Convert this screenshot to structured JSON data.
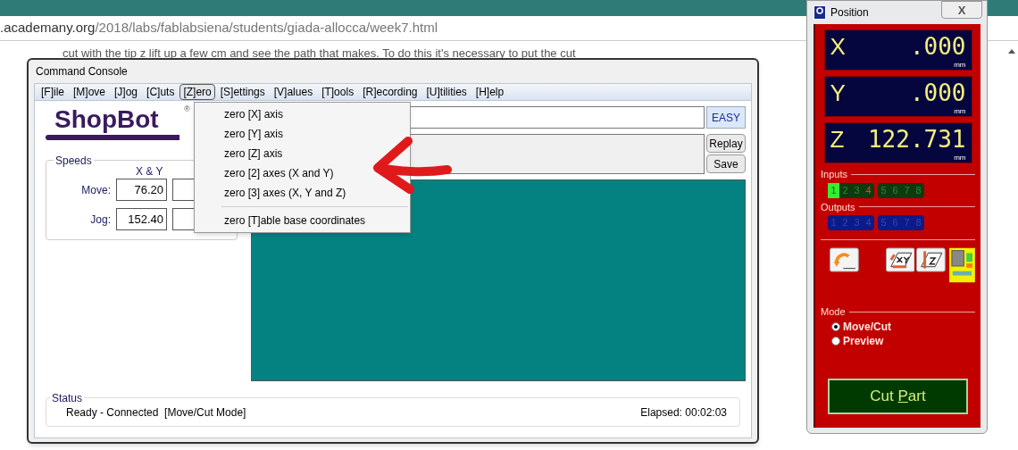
{
  "browser": {
    "url_host": ".academany.org",
    "url_path": "/2018/labs/fablabsiena/students/giada-allocca/week7.html",
    "page_text": "cut with the tip z lift up a few cm and see the path that makes. To do this it's necessary to put the cut"
  },
  "console": {
    "title": "Command Console",
    "menu": [
      {
        "label": "[F]ile",
        "selected": false
      },
      {
        "label": "[M]ove",
        "selected": false
      },
      {
        "label": "[J]og",
        "selected": false
      },
      {
        "label": "[C]uts",
        "selected": false
      },
      {
        "label": "[Z]ero",
        "selected": true
      },
      {
        "label": "[S]ettings",
        "selected": false
      },
      {
        "label": "[V]alues",
        "selected": false
      },
      {
        "label": "[T]ools",
        "selected": false
      },
      {
        "label": "[R]ecording",
        "selected": false
      },
      {
        "label": "[U]tilities",
        "selected": false
      },
      {
        "label": "[H]elp",
        "selected": false
      }
    ],
    "dropdown": [
      {
        "kind": "option",
        "label": "zero [X] axis"
      },
      {
        "kind": "option",
        "label": "zero [Y] axis"
      },
      {
        "kind": "option",
        "label": "zero [Z] axis"
      },
      {
        "kind": "option",
        "label": "zero [2] axes (X and Y)"
      },
      {
        "kind": "option",
        "label": "zero [3] axes (X, Y and Z)"
      },
      {
        "kind": "separator"
      },
      {
        "kind": "option",
        "label": "zero [T]able base coordinates"
      }
    ],
    "logo": {
      "text": "ShopBot",
      "mark": "®"
    },
    "speeds": {
      "title": "Speeds",
      "column_1": "X & Y",
      "rows": [
        {
          "label": "Move:",
          "value": "76.20"
        },
        {
          "label": "Jog:",
          "value": "152.40"
        }
      ]
    },
    "easy_button": "EASY",
    "replay_button": "Replay",
    "save_button": "Save",
    "status": {
      "title": "Status",
      "message": "Ready - Connected  [Move/Cut Mode]",
      "elapsed": "Elapsed: 00:02:03"
    }
  },
  "position": {
    "title": "Position",
    "close": "X",
    "readouts": [
      {
        "axis": "X",
        "value": ".000",
        "unit": "mm"
      },
      {
        "axis": "Y",
        "value": ".000",
        "unit": "mm"
      },
      {
        "axis": "Z",
        "value": "122.731",
        "unit": "mm"
      }
    ],
    "inputs_label": "Inputs",
    "inputs": [
      {
        "label": "1",
        "on": true,
        "alert": false
      },
      {
        "label": "2",
        "on": false,
        "alert": false
      },
      {
        "label": "3",
        "on": false,
        "alert": false
      },
      {
        "label": "4",
        "on": false,
        "alert": true
      },
      {
        "label": "5",
        "on": false,
        "alert": false
      },
      {
        "label": "6",
        "on": false,
        "alert": false
      },
      {
        "label": "7",
        "on": false,
        "alert": false
      },
      {
        "label": "8",
        "on": false,
        "alert": false
      }
    ],
    "outputs_label": "Outputs",
    "outputs": [
      {
        "label": "1",
        "on": false
      },
      {
        "label": "2",
        "on": false
      },
      {
        "label": "3",
        "on": false
      },
      {
        "label": "4",
        "on": false
      },
      {
        "label": "5",
        "on": false
      },
      {
        "label": "6",
        "on": false
      },
      {
        "label": "7",
        "on": false
      },
      {
        "label": "8",
        "on": false
      }
    ],
    "mode_label": "Mode",
    "modes": [
      {
        "label": "Move/Cut",
        "selected": true
      },
      {
        "label": "Preview",
        "selected": false
      }
    ],
    "cut_button": {
      "label_before": "Cut ",
      "mnemonic": "P",
      "label_after": "art"
    }
  }
}
